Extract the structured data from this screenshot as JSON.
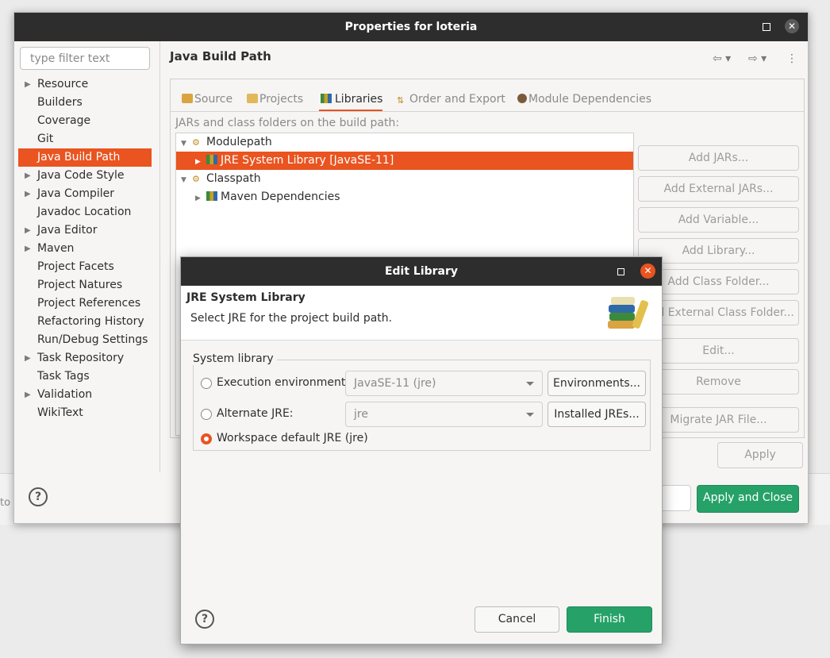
{
  "background": {
    "side_text": "to"
  },
  "properties_window": {
    "title": "Properties for loteria",
    "filter_placeholder": "type filter text",
    "nav_items": [
      {
        "label": "Resource",
        "expandable": true
      },
      {
        "label": "Builders",
        "expandable": false
      },
      {
        "label": "Coverage",
        "expandable": false
      },
      {
        "label": "Git",
        "expandable": false
      },
      {
        "label": "Java Build Path",
        "expandable": false,
        "selected": true
      },
      {
        "label": "Java Code Style",
        "expandable": true
      },
      {
        "label": "Java Compiler",
        "expandable": true
      },
      {
        "label": "Javadoc Location",
        "expandable": false
      },
      {
        "label": "Java Editor",
        "expandable": true
      },
      {
        "label": "Maven",
        "expandable": true
      },
      {
        "label": "Project Facets",
        "expandable": false
      },
      {
        "label": "Project Natures",
        "expandable": false
      },
      {
        "label": "Project References",
        "expandable": false
      },
      {
        "label": "Refactoring History",
        "expandable": false
      },
      {
        "label": "Run/Debug Settings",
        "expandable": false
      },
      {
        "label": "Task Repository",
        "expandable": true
      },
      {
        "label": "Task Tags",
        "expandable": false
      },
      {
        "label": "Validation",
        "expandable": true
      },
      {
        "label": "WikiText",
        "expandable": false
      }
    ],
    "page_title": "Java Build Path",
    "tabs": [
      "Source",
      "Projects",
      "Libraries",
      "Order and Export",
      "Module Dependencies"
    ],
    "active_tab": "Libraries",
    "caption": "JARs and class folders on the build path:",
    "tree": {
      "modulepath": "Modulepath",
      "jre": "JRE System Library [JavaSE-11]",
      "classpath": "Classpath",
      "maven": "Maven Dependencies"
    },
    "side_buttons": {
      "add_jars": "Add JARs...",
      "add_external_jars": "Add External JARs...",
      "add_variable": "Add Variable...",
      "add_library": "Add Library...",
      "add_class_folder": "Add Class Folder...",
      "add_external_class_folder": "Add External Class Folder...",
      "edit": "Edit...",
      "remove": "Remove",
      "migrate": "Migrate JAR File..."
    },
    "apply": "Apply",
    "apply_and_close": "Apply and Close"
  },
  "edit_library_dialog": {
    "title": "Edit Library",
    "header_title": "JRE System Library",
    "header_desc": "Select JRE for the project build path.",
    "group_label": "System library",
    "options": {
      "exec_env": {
        "label": "Execution environment:",
        "combo": "JavaSE-11 (jre)",
        "button": "Environments..."
      },
      "alt_jre": {
        "label": "Alternate JRE:",
        "combo": "jre",
        "button": "Installed JREs..."
      },
      "workspace": {
        "label": "Workspace default JRE (jre)"
      }
    },
    "selected_option": "workspace",
    "cancel": "Cancel",
    "finish": "Finish"
  },
  "colors": {
    "accent": "#e95420",
    "primary_green": "#26a269",
    "titlebar": "#2d2d2d"
  }
}
